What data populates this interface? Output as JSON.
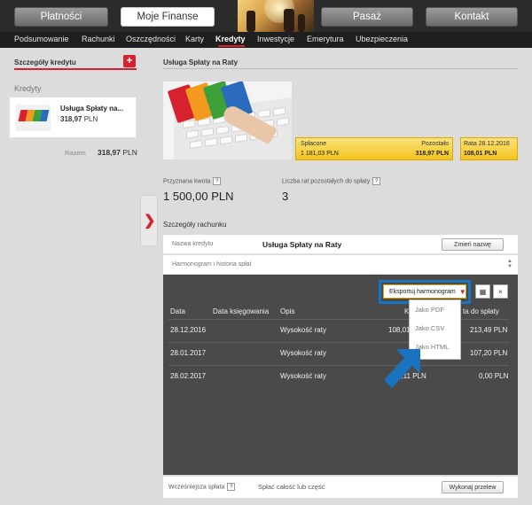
{
  "top_buttons": [
    "Płatności",
    "Moje Finanse",
    "Pasaż",
    "Kontakt"
  ],
  "nav": [
    "Podsumowanie",
    "Rachunki",
    "Oszczędności",
    "Karty",
    "Kredyty",
    "Inwestycje",
    "Emerytura",
    "Ubezpieczenia"
  ],
  "left_panel": {
    "title": "Szczegóły kredytu",
    "add_label": "+",
    "section": "Kredyty",
    "credit_name": "Usługa Spłaty na...",
    "credit_amount": "318,97",
    "currency": "PLN",
    "total_label": "Razem",
    "total_value": "318,97"
  },
  "content": {
    "title": "Usługa Spłaty na Raty",
    "paid_label": "Spłacone",
    "paid_value": "1 181,03 PLN",
    "remaining_label": "Pozostało",
    "remaining_value": "318,97 PLN",
    "rate_label": "Rata 28.12.2016",
    "rate_value": "108,01 PLN",
    "granted_label": "Przyznana kwota",
    "granted_value": "1 500,00 PLN",
    "remaining_rates_label": "Liczba rat pozostałych do spłaty",
    "remaining_rates_value": "3",
    "help_mark": "?",
    "account_details": "Szczegóły rachunku",
    "credit_name_label": "Nazwa kredytu",
    "credit_name_value": "Usługa Spłaty na Raty",
    "rename_button": "Zmień nazwę",
    "schedule_label": "Harmonogram i historia spłat"
  },
  "schedule": {
    "export_label": "Eksportuj harmonogram",
    "export_options": [
      "Jako PDF",
      "Jako CSV",
      "Jako HTML"
    ],
    "columns": [
      "Data",
      "Data księgowania",
      "Opis",
      "K",
      "ta do spłaty"
    ],
    "rows": [
      {
        "date": "28.12.2016",
        "desc": "Wysokość raty",
        "amount": "108,01",
        "remaining": "213,49 PLN"
      },
      {
        "date": "28.01.2017",
        "desc": "Wysokość raty",
        "amount": "",
        "remaining": "107,20 PLN"
      },
      {
        "date": "28.02.2017",
        "desc": "Wysokość raty",
        "amount": "1,11 PLN",
        "remaining": "0,00 PLN"
      }
    ],
    "close_label": "×"
  },
  "bottom": {
    "early_repayment": "Wcześniejsza spłata",
    "repay_all": "Spłać całość lub część",
    "make_transfer": "Wykonaj przelew"
  },
  "colors": {
    "accent_red": "#d6222f",
    "highlight_blue": "#1a73bf",
    "yellow": "#f3c41d",
    "dark_panel": "#4a4a4a"
  }
}
